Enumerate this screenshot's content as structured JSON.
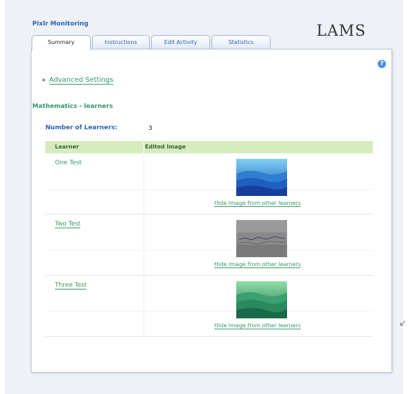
{
  "app": {
    "title": "Pixlr Monitoring",
    "logo": "LAMS"
  },
  "tabs": [
    {
      "label": "Summary",
      "active": true
    },
    {
      "label": "Instructions",
      "active": false
    },
    {
      "label": "Edit Activity",
      "active": false
    },
    {
      "label": "Statistics",
      "active": false
    }
  ],
  "help": {
    "icon": "help-icon",
    "glyph": "?"
  },
  "advanced": {
    "expander": "+",
    "label": "Advanced Settings"
  },
  "section": {
    "heading": "Mathematics - learners"
  },
  "learners_count": {
    "label": "Number of Learners:",
    "value": "3"
  },
  "table": {
    "headers": [
      "Learner",
      "Edited Image"
    ],
    "rows": [
      {
        "learner": "One Test",
        "linked": false,
        "hide_label": "Hide Image from other learners",
        "image": "blue-mountains"
      },
      {
        "learner": "Two Test",
        "linked": true,
        "hide_label": "Hide Image from other learners",
        "image": "grey-texture"
      },
      {
        "learner": "Three Test",
        "linked": true,
        "hide_label": "Hide Image from other learners",
        "image": "green-mountains"
      }
    ]
  },
  "colors": {
    "link_green": "#339966",
    "header_blue": "#2b63b3",
    "table_header_bg": "#d6ecbf"
  }
}
